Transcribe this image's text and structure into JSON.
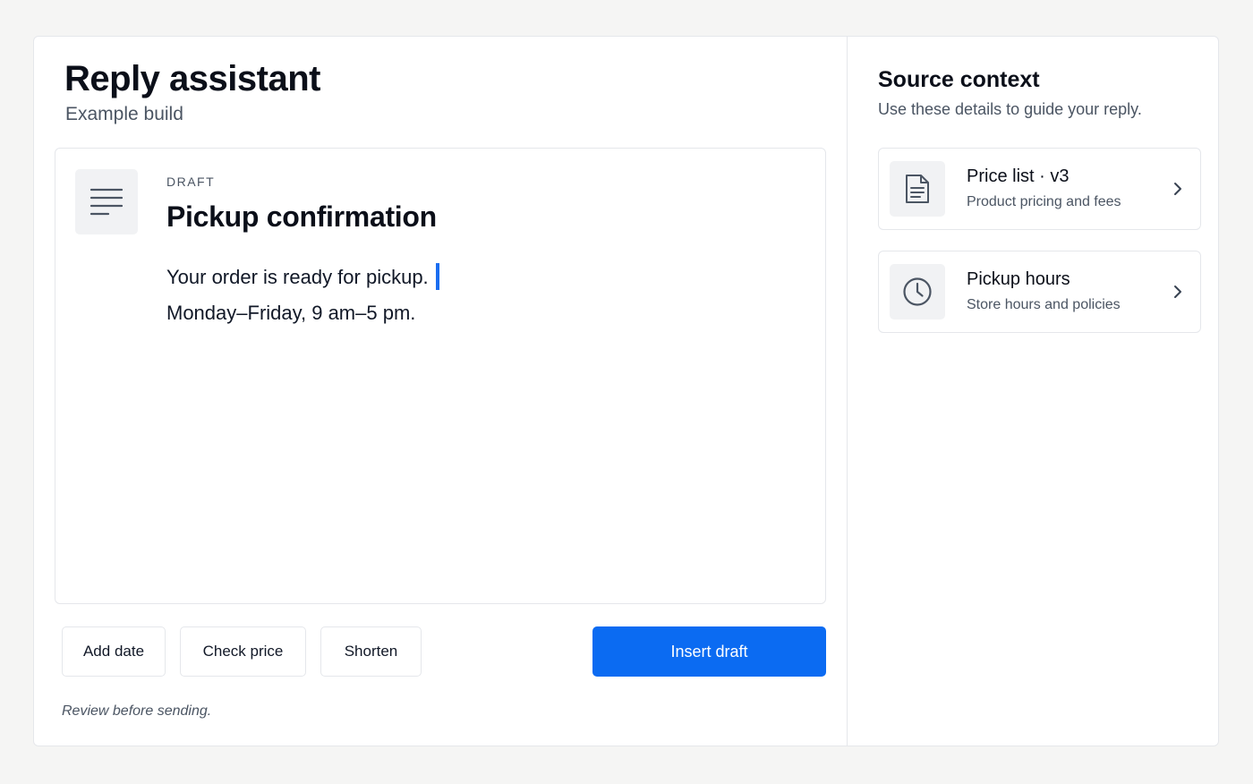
{
  "app": {
    "title": "Reply assistant",
    "subtitle": "Example build"
  },
  "draft": {
    "kicker": "DRAFT",
    "title": "Pickup confirmation",
    "lines": [
      "Your order is ready for pickup.",
      "Monday–Friday, 9 am–5 pm."
    ],
    "icon": "document-lines-icon"
  },
  "actions": {
    "add_date": "Add date",
    "check_price": "Check price",
    "shorten": "Shorten",
    "insert": "Insert draft"
  },
  "footnote": "Review before sending.",
  "context": {
    "title": "Source context",
    "subtitle": "Use these details to guide your reply.",
    "sources": [
      {
        "name": "Price list · v3",
        "description": "Product pricing and fees",
        "icon": "file-text-icon"
      },
      {
        "name": "Pickup hours",
        "description": "Store hours and policies",
        "icon": "clock-icon"
      }
    ]
  },
  "colors": {
    "accent": "#0b6bf2",
    "caret": "#1a6df0",
    "background": "#f5f5f4"
  }
}
